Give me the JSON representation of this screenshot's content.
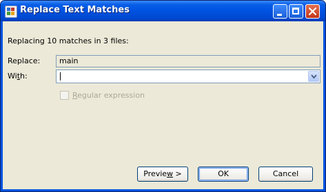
{
  "window": {
    "title": "Replace Text Matches",
    "controls": {
      "minimize_icon": "minimize-icon",
      "maximize_icon": "maximize-icon",
      "close_icon": "close-icon"
    }
  },
  "dialog": {
    "summary": "Replacing 10 matches in 3 files:",
    "replace_label": "Replace:",
    "replace_value": "main",
    "with_label_pre": "Wi",
    "with_label_mnemonic": "t",
    "with_label_post": "h:",
    "with_value": "",
    "regex_checked": false,
    "regex_label_mnemonic": "R",
    "regex_label_rest": "egular expression"
  },
  "buttons": {
    "preview_pre": "Previe",
    "preview_mnemonic": "w",
    "preview_post": " >",
    "ok": "OK",
    "cancel": "Cancel"
  },
  "colors": {
    "titlebar": "#0054e3",
    "dialog_bg": "#ece9d8",
    "disabled_text": "#aca899",
    "close_button": "#c2351a"
  }
}
